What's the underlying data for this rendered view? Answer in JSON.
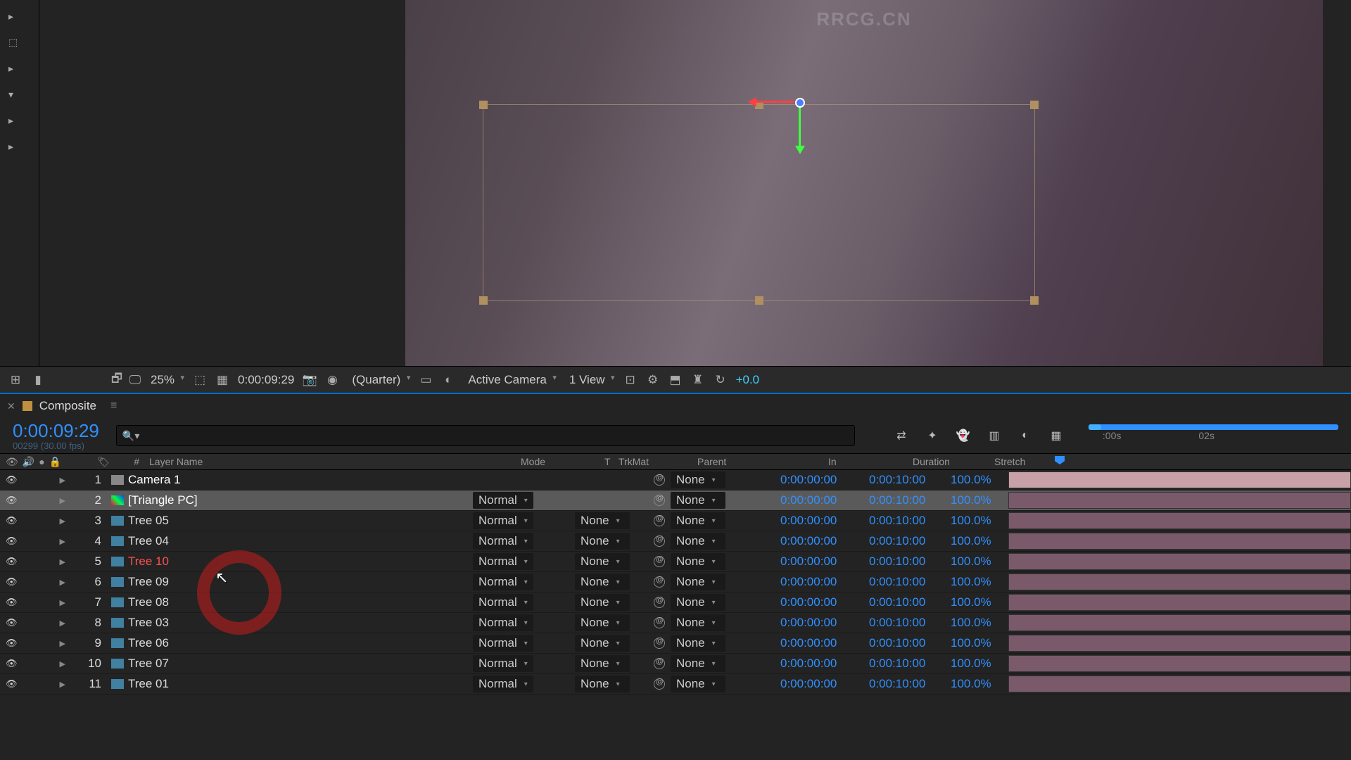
{
  "watermark": "RRCG.CN",
  "viewerToolbar": {
    "zoom": "25%",
    "timecode": "0:00:09:29",
    "resolution": "(Quarter)",
    "camera": "Active Camera",
    "views": "1 View",
    "exposure": "+0.0"
  },
  "timelineTab": {
    "name": "Composite"
  },
  "timecode": {
    "main": "0:00:09:29",
    "sub": "00299 (30.00 fps)"
  },
  "ruler": {
    "ticks": [
      ":00s",
      "02s"
    ]
  },
  "columns": {
    "num": "#",
    "layerName": "Layer Name",
    "mode": "Mode",
    "t": "T",
    "trkMat": "TrkMat",
    "parent": "Parent",
    "in": "In",
    "duration": "Duration",
    "stretch": "Stretch"
  },
  "layers": [
    {
      "num": "1",
      "name": "Camera 1",
      "mode": "",
      "trkmat": "",
      "parent": "None",
      "in": "0:00:00:00",
      "dur": "0:00:10:00",
      "stretch": "100.0%",
      "color": "color-pink",
      "icon": "cam",
      "nameClass": "cam",
      "selected": false,
      "barClass": "cam"
    },
    {
      "num": "2",
      "name": "[Triangle PC]",
      "mode": "Normal",
      "trkmat": "",
      "parent": "None",
      "in": "0:00:00:00",
      "dur": "0:00:10:00",
      "stretch": "100.0%",
      "color": "color-tan",
      "icon": "color",
      "nameClass": "sel",
      "selected": true,
      "barClass": ""
    },
    {
      "num": "3",
      "name": "Tree 05",
      "mode": "Normal",
      "trkmat": "None",
      "parent": "None",
      "in": "0:00:00:00",
      "dur": "0:00:10:00",
      "stretch": "100.0%",
      "color": "color-tan",
      "icon": "",
      "nameClass": "",
      "selected": false,
      "barClass": ""
    },
    {
      "num": "4",
      "name": "Tree 04",
      "mode": "Normal",
      "trkmat": "None",
      "parent": "None",
      "in": "0:00:00:00",
      "dur": "0:00:10:00",
      "stretch": "100.0%",
      "color": "color-tan",
      "icon": "",
      "nameClass": "",
      "selected": false,
      "barClass": ""
    },
    {
      "num": "5",
      "name": "Tree 10",
      "mode": "Normal",
      "trkmat": "None",
      "parent": "None",
      "in": "0:00:00:00",
      "dur": "0:00:10:00",
      "stretch": "100.0%",
      "color": "color-lav",
      "icon": "",
      "nameClass": "red",
      "selected": false,
      "barClass": ""
    },
    {
      "num": "6",
      "name": "Tree 09",
      "mode": "Normal",
      "trkmat": "None",
      "parent": "None",
      "in": "0:00:00:00",
      "dur": "0:00:10:00",
      "stretch": "100.0%",
      "color": "color-lav",
      "icon": "",
      "nameClass": "",
      "selected": false,
      "barClass": ""
    },
    {
      "num": "7",
      "name": "Tree 08",
      "mode": "Normal",
      "trkmat": "None",
      "parent": "None",
      "in": "0:00:00:00",
      "dur": "0:00:10:00",
      "stretch": "100.0%",
      "color": "color-lav",
      "icon": "",
      "nameClass": "",
      "selected": false,
      "barClass": ""
    },
    {
      "num": "8",
      "name": "Tree 03",
      "mode": "Normal",
      "trkmat": "None",
      "parent": "None",
      "in": "0:00:00:00",
      "dur": "0:00:10:00",
      "stretch": "100.0%",
      "color": "color-tan",
      "icon": "",
      "nameClass": "",
      "selected": false,
      "barClass": ""
    },
    {
      "num": "9",
      "name": "Tree 06",
      "mode": "Normal",
      "trkmat": "None",
      "parent": "None",
      "in": "0:00:00:00",
      "dur": "0:00:10:00",
      "stretch": "100.0%",
      "color": "color-lav",
      "icon": "",
      "nameClass": "",
      "selected": false,
      "barClass": ""
    },
    {
      "num": "10",
      "name": "Tree 07",
      "mode": "Normal",
      "trkmat": "None",
      "parent": "None",
      "in": "0:00:00:00",
      "dur": "0:00:10:00",
      "stretch": "100.0%",
      "color": "color-lav",
      "icon": "",
      "nameClass": "",
      "selected": false,
      "barClass": ""
    },
    {
      "num": "11",
      "name": "Tree 01",
      "mode": "Normal",
      "trkmat": "None",
      "parent": "None",
      "in": "0:00:00:00",
      "dur": "0:00:10:00",
      "stretch": "100.0%",
      "color": "color-tan",
      "icon": "",
      "nameClass": "",
      "selected": false,
      "barClass": ""
    }
  ]
}
